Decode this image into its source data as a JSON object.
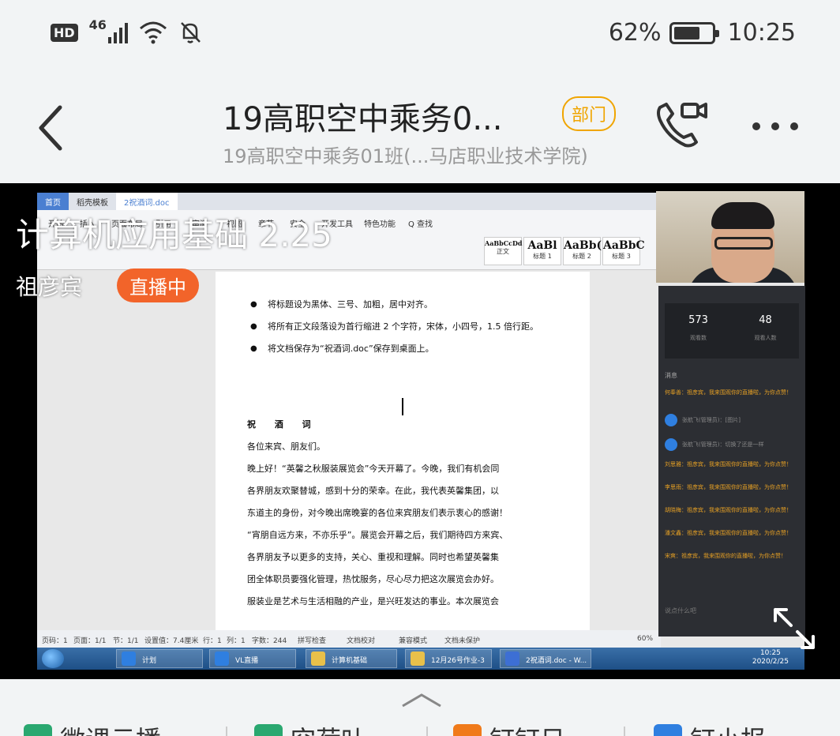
{
  "status_bar": {
    "hd": "HD",
    "network": "46",
    "battery_text": "62%",
    "battery_level": 0.62,
    "time": "10:25",
    "icons": [
      "signal-icon",
      "wifi-icon",
      "mute-bell-icon",
      "battery-icon"
    ]
  },
  "header": {
    "back_icon": "back-chevron-icon",
    "title": "19高职空中乘务0...",
    "badge": "部门",
    "subtitle": "19高职空中乘务01班(...马店职业技术学院)",
    "call_icon": "video-call-icon",
    "more_icon": "more-icon"
  },
  "stream": {
    "title": "计算机应用基础 2.25",
    "host": "祖彦宾",
    "live_badge": "直播中",
    "expand_icon": "fullscreen-exit-icon"
  },
  "word": {
    "tabs": [
      {
        "label": "首页",
        "kind": "home"
      },
      {
        "label": "稻壳模板",
        "kind": "normal"
      },
      {
        "label": "2祝酒词.doc",
        "kind": "active"
      }
    ],
    "menu": [
      "开始",
      "插入",
      "页面布局",
      "引用",
      "审阅",
      "视图",
      "章节",
      "安全",
      "开发工具",
      "特色功能",
      "Q 查找"
    ],
    "styles": [
      {
        "sample": "AaBbCcDd",
        "name": "正文"
      },
      {
        "sample": "AaBl",
        "name": "标题 1"
      },
      {
        "sample": "AaBb(",
        "name": "标题 2"
      },
      {
        "sample": "AaBbC",
        "name": "标题 3"
      }
    ],
    "bullets": [
      "将标题设为黑体、三号、加粗，居中对齐。",
      "将所有正文段落设为首行缩进 2 个字符，宋体，小四号，1.5 倍行距。",
      "将文档保存为“祝酒词.doc”保存到桌面上。"
    ],
    "doc_title": "祝 酒 词",
    "greeting": "各位来宾、朋友们。",
    "body": [
      "晚上好！“英馨之秋服装展览会”今天开幕了。今晚，我们有机会同",
      "各界朋友欢聚替城，感到十分的荣幸。在此，我代表英馨集团，以",
      "东道主的身份，对今晚出席晚宴的各位来宾朋友们表示衷心的感谢！",
      "“宵朋自远方来，不亦乐乎”。展览会开幕之后，我们期待四方来宾、",
      "各界朋友予以更多的支持，关心、重视和理解。同时也希望英馨集",
      "团全体职员要强化管理，热忱服务，尽心尽力把这次展览会办好。",
      "服装业是艺术与生活相融的产业，是兴旺发达的事业。本次展览会"
    ],
    "status": [
      "页码：1",
      "页面：1/1",
      "节：1/1",
      "设置值：7.4厘米",
      "行：1",
      "列：1",
      "字数：244",
      "拼写检查",
      "文档校对",
      "兼容模式",
      "文档未保护",
      "60%"
    ],
    "taskbar": [
      "计划",
      "VL直播",
      "计算机基础",
      "12月26号作业-3",
      "2祝酒词.doc - W..."
    ],
    "clock_time": "10:25",
    "clock_date": "2020/2/25"
  },
  "live_panel": {
    "viewers": "573",
    "viewers_label": "观看数",
    "online": "48",
    "online_label": "观看人数",
    "messages_header": "消息",
    "messages": [
      {
        "text": "何奉善：祖彦宾，我来围观你的直播啦，为你点赞！",
        "kind": "user"
      },
      {
        "text": "张航飞(管理员)：[图片]",
        "kind": "sys"
      },
      {
        "text": "张航飞(管理员)：切换了还是一样",
        "kind": "sys"
      },
      {
        "text": "刘思雅：祖彦宾，我来围观你的直播啦，为你点赞！",
        "kind": "user"
      },
      {
        "text": "李思雨：祖彦宾，我来围观你的直播啦，为你点赞！",
        "kind": "user"
      },
      {
        "text": "胡晓梅：祖彦宾，我来围观你的直播啦，为你点赞！",
        "kind": "user"
      },
      {
        "text": "潘文鑫：祖彦宾，我来围观你的直播啦，为你点赞！",
        "kind": "user"
      },
      {
        "text": "宋爽：祖彦宾，我来围观你的直播啦，为你点赞！",
        "kind": "user"
      }
    ],
    "input_hint": "说点什么吧"
  },
  "bottom_bar": {
    "collapse_icon": "chevron-up-icon",
    "shortcuts": [
      "微课云播",
      "空荷叶",
      "钉钉日",
      "钉小报"
    ]
  }
}
